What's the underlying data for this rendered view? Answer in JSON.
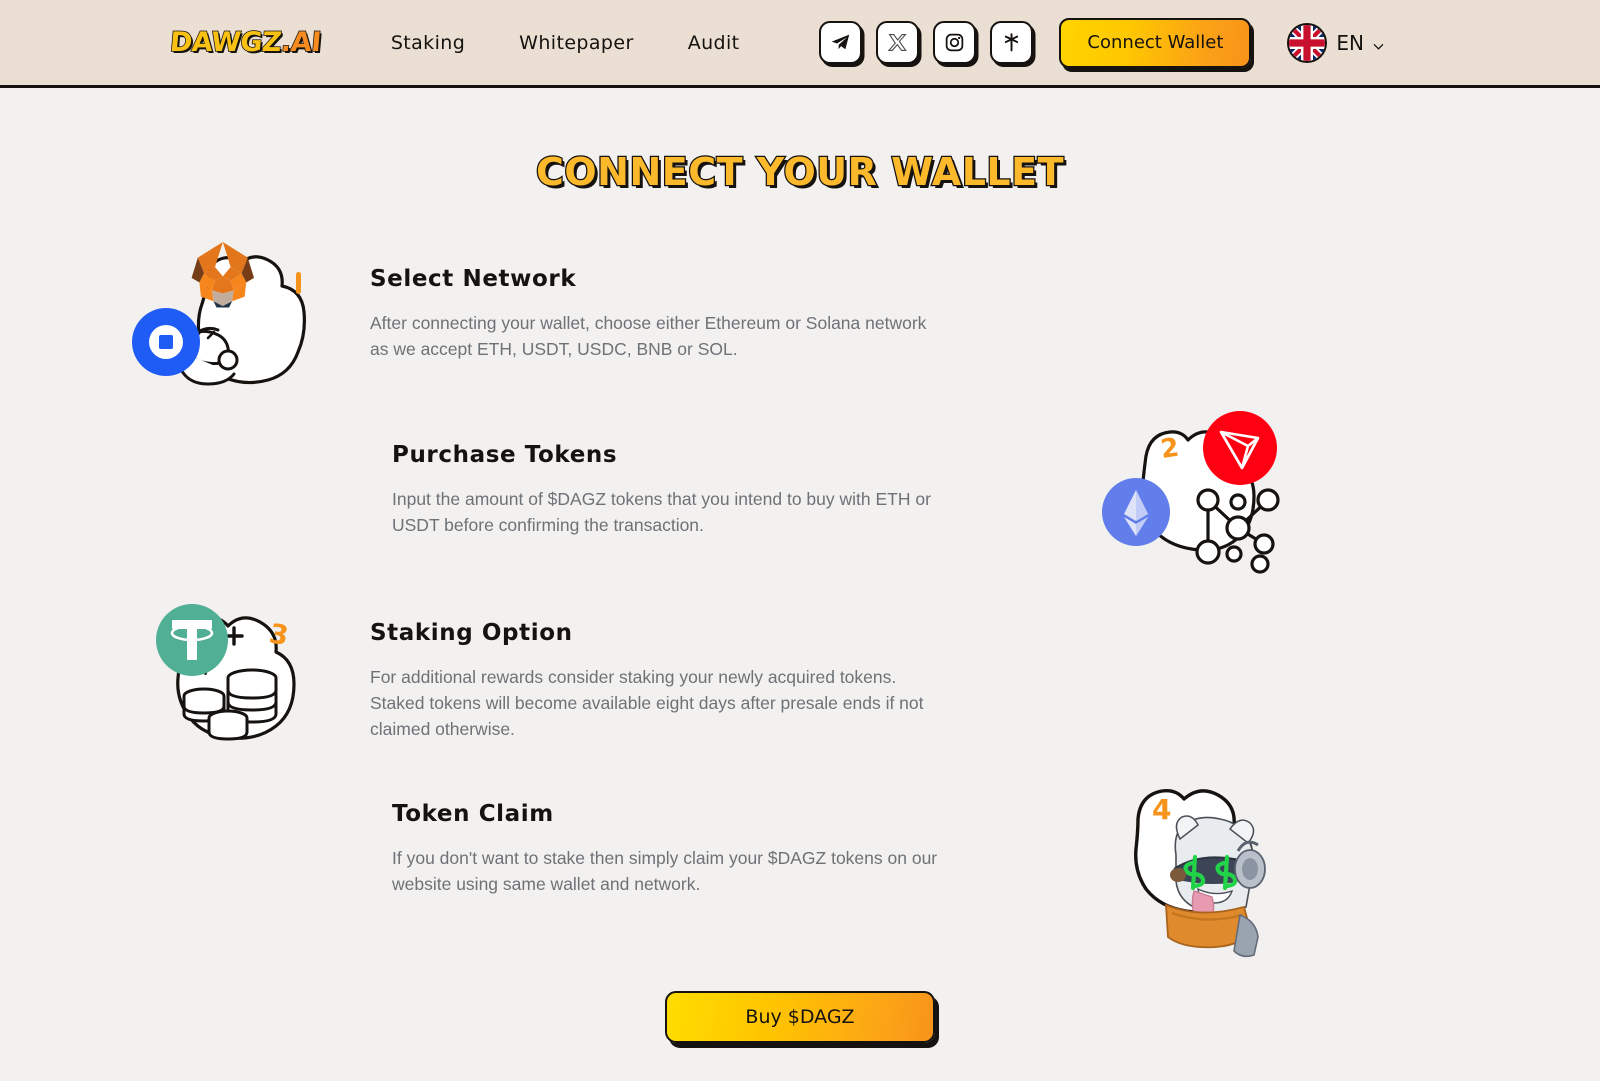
{
  "header": {
    "brand_part1": "DAWGZ",
    "brand_part2": ".AI",
    "nav": [
      {
        "label": "Staking",
        "name": "nav-staking"
      },
      {
        "label": "Whitepaper",
        "name": "nav-whitepaper"
      },
      {
        "label": "Audit",
        "name": "nav-audit"
      }
    ],
    "socials": [
      {
        "icon": "telegram-icon",
        "label": "Telegram"
      },
      {
        "icon": "x-twitter-icon",
        "label": "X"
      },
      {
        "icon": "instagram-icon",
        "label": "Instagram"
      },
      {
        "icon": "linktree-icon",
        "label": "Linktree"
      }
    ],
    "connect_wallet_label": "Connect Wallet",
    "language": {
      "code": "EN",
      "flag": "uk-flag-icon"
    }
  },
  "main": {
    "title": "CONNECT YOUR WALLET",
    "steps": [
      {
        "number": "1",
        "title": "Select Network",
        "description": "After connecting your wallet, choose either Ethereum or Solana network as we accept ETH, USDT, USDC, BNB or SOL.",
        "illustration": "metamask-coinbase-wallet-illustration"
      },
      {
        "number": "2",
        "title": "Purchase Tokens",
        "description": "Input the amount of $DAGZ tokens that you intend to buy with ETH or USDT before confirming the transaction.",
        "illustration": "tron-ethereum-network-illustration"
      },
      {
        "number": "3",
        "title": "Staking Option",
        "description": "For additional rewards consider staking your newly acquired tokens. Staked tokens will become available eight days after presale ends if not claimed otherwise.",
        "illustration": "tether-coin-stack-illustration"
      },
      {
        "number": "4",
        "title": "Token Claim",
        "description": "If you don't want to stake then simply claim your $DAGZ tokens on our website using same wallet and network.",
        "illustration": "dawgz-mascot-illustration"
      }
    ],
    "buy_button_label": "Buy $DAGZ"
  },
  "colors": {
    "header_bg": "#eadfd2",
    "page_bg": "#f2f1ef",
    "accent_yellow": "#ffc800",
    "accent_orange": "#f7931a",
    "ink": "#15120f",
    "body_text": "#6e7277",
    "tron_red": "#ff0013",
    "ethereum_purple": "#627eea",
    "tether_green": "#50af95",
    "coinbase_blue": "#1f5cf5"
  }
}
